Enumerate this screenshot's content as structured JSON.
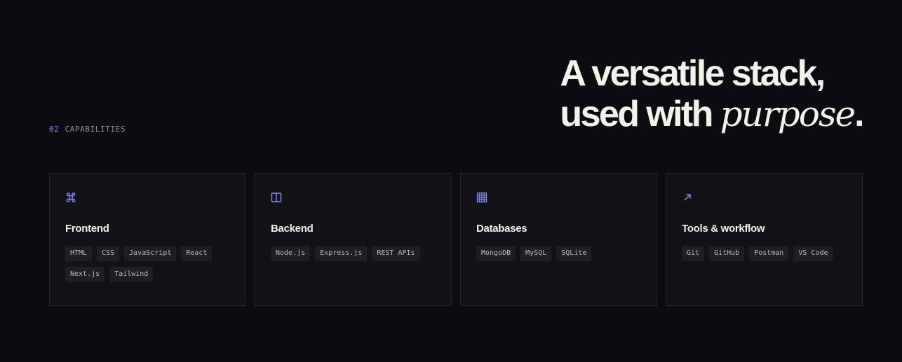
{
  "section": {
    "number": "02",
    "name": "CAPABILITIES"
  },
  "headline": {
    "line1": "A versatile stack,",
    "line2_plain": "used with ",
    "line2_accent": "purpose",
    "line2_end": "."
  },
  "colors": {
    "background": "#0c0d10",
    "card_background": "#121317",
    "card_border": "#24262d",
    "accent": "#8b8ff5",
    "heading": "#f3f1ea",
    "tag_background": "#1d1f25",
    "tag_text": "#b8bbc4"
  },
  "cards": [
    {
      "icon": "command-icon",
      "title": "Frontend",
      "tags": [
        "HTML",
        "CSS",
        "JavaScript",
        "React",
        "Next.js",
        "Tailwind"
      ]
    },
    {
      "icon": "panel-icon",
      "title": "Backend",
      "tags": [
        "Node.js",
        "Express.js",
        "REST APIs"
      ]
    },
    {
      "icon": "grid-icon",
      "title": "Databases",
      "tags": [
        "MongoDB",
        "MySQL",
        "SQLite"
      ]
    },
    {
      "icon": "arrow-up-right-icon",
      "title": "Tools & workflow",
      "tags": [
        "Git",
        "GitHub",
        "Postman",
        "VS Code"
      ]
    }
  ]
}
